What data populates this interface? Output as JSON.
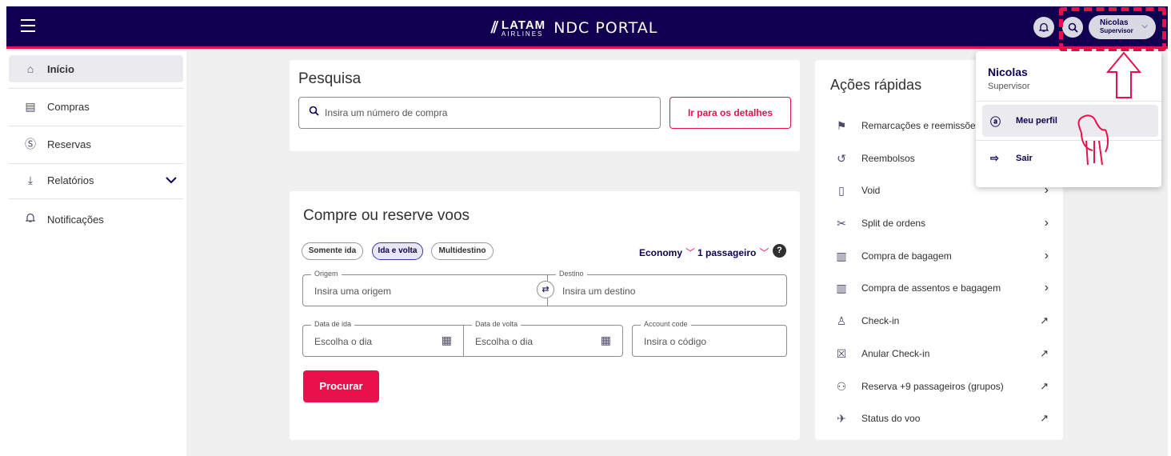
{
  "header": {
    "brand_line1": "LATAM",
    "brand_line2": "AIRLINES",
    "portal": "NDC PORTAL",
    "user_name": "Nicolas",
    "user_role": "Supervisor"
  },
  "sidebar": {
    "items": [
      {
        "label": "Início",
        "icon": "home-icon"
      },
      {
        "label": "Compras",
        "icon": "clipboard-icon"
      },
      {
        "label": "Reservas",
        "icon": "money-icon"
      },
      {
        "label": "Relatórios",
        "icon": "download-icon"
      },
      {
        "label": "Notificações",
        "icon": "bell-icon"
      }
    ]
  },
  "search": {
    "title": "Pesquisa",
    "placeholder": "Insira um número de compra",
    "button": "Ir para os detalhes"
  },
  "booking": {
    "title": "Compre ou reserve voos",
    "trip_types": [
      "Somente ida",
      "Ida e volta",
      "Multidestino"
    ],
    "selected_trip_type": "Ida e volta",
    "cabin": "Economy",
    "passengers": "1 passageiro",
    "origin_label": "Origem",
    "origin_placeholder": "Insira uma origem",
    "destination_label": "Destino",
    "destination_placeholder": "Insira um destino",
    "depart_label": "Data de ida",
    "depart_placeholder": "Escolha o dia",
    "return_label": "Data de volta",
    "return_placeholder": "Escolha o dia",
    "account_label": "Account code",
    "account_placeholder": "Insira o código",
    "search_button": "Procurar"
  },
  "quick_actions": {
    "title": "Ações rápidas",
    "items": [
      {
        "label": "Remarcações e reemissões",
        "icon": "signpost-icon",
        "arrow": "chevron"
      },
      {
        "label": "Reembolsos",
        "icon": "refund-icon",
        "arrow": "chevron"
      },
      {
        "label": "Void",
        "icon": "document-icon",
        "arrow": "chevron"
      },
      {
        "label": "Split de ordens",
        "icon": "scissors-icon",
        "arrow": "chevron"
      },
      {
        "label": "Compra de bagagem",
        "icon": "luggage-icon",
        "arrow": "chevron"
      },
      {
        "label": "Compra de assentos e bagagem",
        "icon": "luggage-icon",
        "arrow": "chevron"
      },
      {
        "label": "Check-in",
        "icon": "person-icon",
        "arrow": "external"
      },
      {
        "label": "Anular Check-in",
        "icon": "cancel-icon",
        "arrow": "external"
      },
      {
        "label": "Reserva +9 passageiros (grupos)",
        "icon": "group-icon",
        "arrow": "external"
      },
      {
        "label": "Status do voo",
        "icon": "plane-icon",
        "arrow": "external"
      }
    ]
  },
  "user_menu": {
    "name": "Nicolas",
    "role": "Supervisor",
    "items": [
      {
        "label": "Meu perfil",
        "icon": "profile-icon"
      },
      {
        "label": "Sair",
        "icon": "logout-icon"
      }
    ]
  },
  "colors": {
    "header_bg": "#10004f",
    "accent": "#e8114b"
  }
}
